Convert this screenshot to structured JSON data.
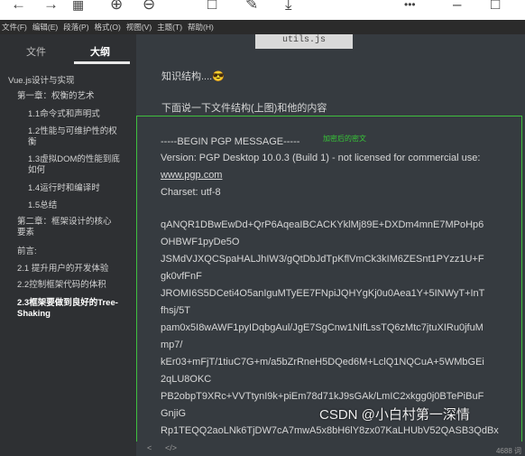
{
  "toolbar": {
    "icons": [
      "back-arrow-icon",
      "forward-arrow-icon",
      "grid-icon",
      "zoom-in-icon",
      "zoom-out-icon",
      "square-icon",
      "edit-icon",
      "download-icon",
      "more-icon",
      "minimize-icon",
      "maximize-icon"
    ],
    "more_glyph": "•••"
  },
  "menubar": {
    "items": [
      "文件(F)",
      "编辑(E)",
      "段落(P)",
      "格式(O)",
      "视图(V)",
      "主题(T)",
      "帮助(H)"
    ]
  },
  "sidebar": {
    "tab_file": "文件",
    "tab_outline": "大纲",
    "outline": [
      "Vue.js设计与实现",
      "第一章：权衡的艺术",
      "1.1命令式和声明式",
      "1.2性能与可维护性的权",
      "衡",
      "1.3虚拟DOM的性能到底",
      "如何",
      "1.4运行时和编译时",
      "1.5总结",
      "第二章：框架设计的核心",
      "要素",
      "前言:",
      "2.1 提升用户的开发体验",
      "2.2控制框架代码的体积",
      "2.3框架要做到良好的Tree-",
      "Shaking"
    ]
  },
  "editor": {
    "image_caption": "utils.js",
    "line1": "知识结构....😎",
    "line2": "下面说一下文件结构(上图)和他的内容",
    "annotation": "加密后的密文",
    "code": [
      "-----BEGIN PGP MESSAGE-----",
      "Version: PGP Desktop 10.0.3 (Build 1) - not licensed for commercial use:",
      "www.pgp.com",
      "Charset: utf-8",
      "",
      "qANQR1DBwEwDd+QrP6AqeaIBCACKYklMj89E+DXDm4mnE7MPoHp6",
      "OHBWF1pyDe5O",
      "JSMdVJXQCSpaHALJhIW3/gQtDbJdTpKflVmCk3kIM6ZESnt1PYzz1U+F",
      "gk0vfFnF",
      "JROMI6S5DCeti4O5anIguMTyEE7FNpiJQHYgKj0u0Aea1Y+5INWyT+InT",
      "fhsj/5T",
      "pam0x5I8wAWF1pyIDqbgAul/JgE7SgCnw1NIfLssTQ6zMtc7jtuXIRu0jfuM",
      "mp7/",
      "kEr03+mFjT/1tiuC7G+m/a5bZrRneH5DQed6M+LclQ1NQCuA+5WMbGEi",
      "2qLU8OKC",
      "PB2obpT9XRc+VVTtynI9k+piEm78d71kJ9sGAk/LmIC2xkgg0j0BTePiBuF",
      "GnjiG",
      "Rp1TEQQ2aoLNk6TjDW7cA7mwA5x8bH6lY8zx07KaLHUbV52QASB3QdBx"
    ]
  },
  "footer": {
    "left_arrow": "<",
    "code_toggle": "</>",
    "watermark": "CSDN @小白村第一深情",
    "word_count": "4688 词"
  }
}
